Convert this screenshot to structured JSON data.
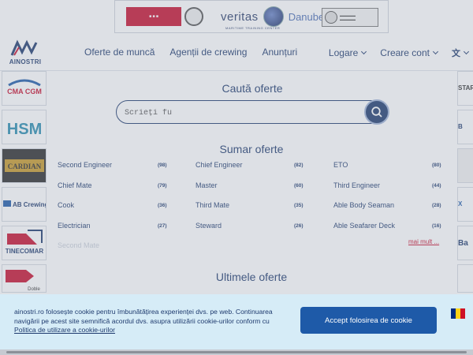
{
  "banner": {
    "brand_left": "veritas",
    "brand_right": "Danube",
    "subtitle": "MARITIME TRAINING CENTER"
  },
  "header": {
    "logo_text": "AINOSTRI",
    "nav": [
      "Oferte de muncă",
      "Agenții de crewing",
      "Anunțuri"
    ],
    "login": "Logare",
    "create_account": "Creare cont",
    "lang_icon": "translate-icon"
  },
  "left_partners": [
    "CMA CGM",
    "HSM",
    "CARDIAN",
    "AB Crewing",
    "TINECOMAR",
    "Doble"
  ],
  "right_partners": [
    "STAR",
    "B",
    "",
    "X",
    "Ba",
    ""
  ],
  "search": {
    "title": "Caută oferte",
    "value": "Scrieți fu",
    "placeholder": "Scrieți fu . . ."
  },
  "summary": {
    "title": "Sumar oferte",
    "jobs": [
      {
        "name": "Second Engineer",
        "count": "(98)"
      },
      {
        "name": "Chief Engineer",
        "count": "(82)"
      },
      {
        "name": "ETO",
        "count": "(80)"
      },
      {
        "name": "Chief Mate",
        "count": "(79)"
      },
      {
        "name": "Master",
        "count": "(60)"
      },
      {
        "name": "Third Engineer",
        "count": "(44)"
      },
      {
        "name": "Cook",
        "count": "(36)"
      },
      {
        "name": "Third Mate",
        "count": "(35)"
      },
      {
        "name": "Able Body Seaman",
        "count": "(28)"
      },
      {
        "name": "Electrician",
        "count": "(27)"
      },
      {
        "name": "Steward",
        "count": "(26)"
      },
      {
        "name": "Able Seafarer Deck",
        "count": "(16)"
      }
    ],
    "more": "mai mult ...",
    "faded_item": "Second Mate"
  },
  "latest": {
    "title": "Ultimele oferte"
  },
  "cookie": {
    "text": "ainostri.ro folosește cookie pentru îmbunătățirea experienței dvs. pe web. Continuarea navigării pe acest site semnifică acordul dvs. asupra utilizării cookie-urilor conform cu",
    "link": "Politica de utilizare a cookie-urilor",
    "accept": "Accept folosirea de cookie",
    "flag_colors": [
      "#002b7f",
      "#fcd116",
      "#ce1126"
    ]
  },
  "colors": {
    "primary": "#1e3a6e",
    "accent": "#c8102e",
    "cookie_bg": "#d6ecf7"
  }
}
